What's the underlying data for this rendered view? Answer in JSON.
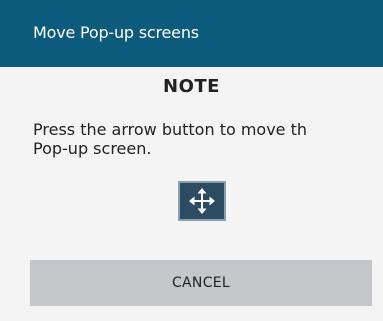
{
  "dialog": {
    "title": "Move Pop-up screens",
    "note_title": "NOTE",
    "message": "Press the arrow button to move th\nPop-up screen.",
    "move_button_icon": "move-arrows-icon",
    "cancel_label": "CANCEL"
  },
  "colors": {
    "header_bg": "#0c5a7c",
    "body_bg": "#f4f4f5",
    "move_button_bg": "#2c4c64",
    "cancel_button_bg": "#c4c6c9"
  }
}
